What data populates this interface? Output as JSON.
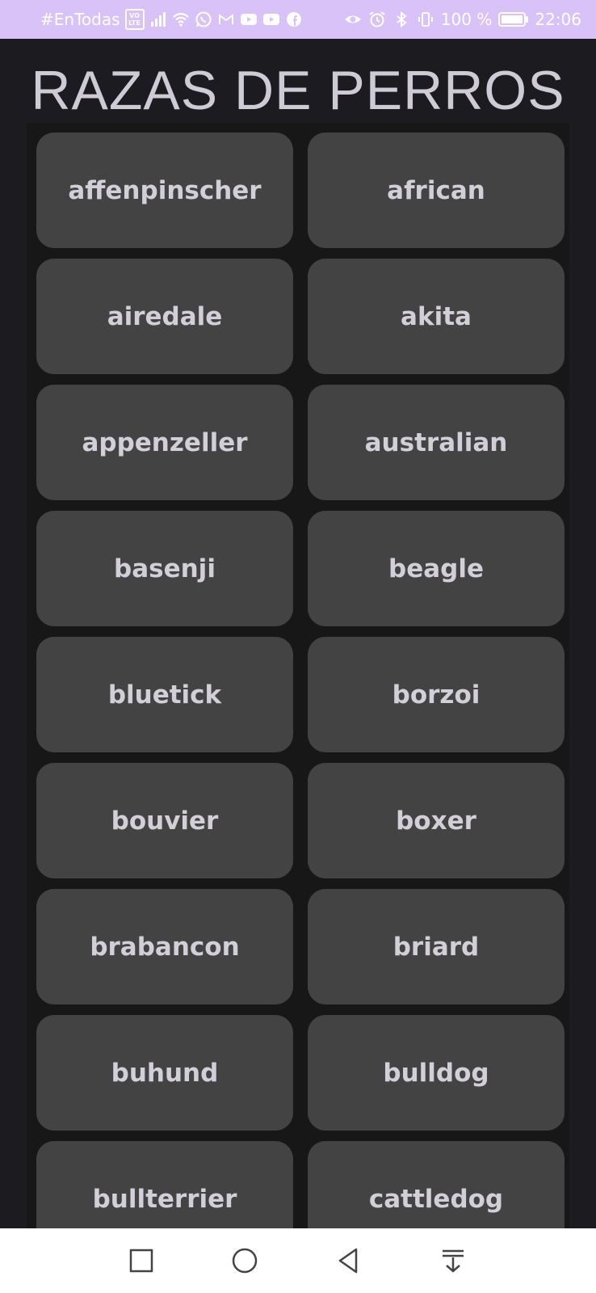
{
  "status_bar": {
    "carrier": "#EnTodas",
    "volte_top": "VO",
    "volte_bottom": "LTE",
    "battery_pct": "100 %",
    "time": "22:06",
    "icons": [
      "signal-icon",
      "wifi-icon",
      "whatsapp-icon",
      "gmail-icon",
      "youtube-icon",
      "youtube-icon",
      "facebook-icon",
      "eye-icon",
      "alarm-icon",
      "bluetooth-icon",
      "vibrate-icon",
      "battery-icon"
    ]
  },
  "page": {
    "title": "RAZAS DE PERROS"
  },
  "breeds": [
    "affenpinscher",
    "african",
    "airedale",
    "akita",
    "appenzeller",
    "australian",
    "basenji",
    "beagle",
    "bluetick",
    "borzoi",
    "bouvier",
    "boxer",
    "brabancon",
    "briard",
    "buhund",
    "bulldog",
    "bullterrier",
    "cattledog"
  ],
  "nav_bar": {
    "icons": [
      "recents-square-icon",
      "home-circle-icon",
      "back-triangle-icon",
      "notification-pulldown-icon"
    ]
  },
  "colors": {
    "status_bar_bg": "#d9c2f7",
    "app_bg": "#1c1b1f",
    "list_bg": "#171717",
    "card_bg": "#434343",
    "text": "#d2cfd8"
  }
}
